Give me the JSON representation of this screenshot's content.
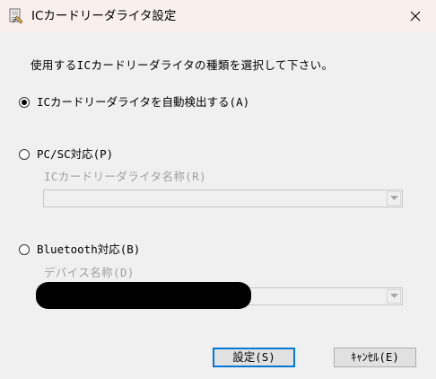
{
  "window": {
    "title": "ICカードリーダライタ設定",
    "icon": "card-reader-settings-icon",
    "close_icon": "close-icon"
  },
  "instruction": "使用するICカードリーダライタの種類を選択して下さい。",
  "options": {
    "auto": {
      "label": "ICカードリーダライタを自動検出する(A)",
      "checked": true
    },
    "pcsc": {
      "label": "PC/SC対応(P)",
      "checked": false,
      "field_label": "ICカードリーダライタ名称(R)",
      "field_value": ""
    },
    "bluetooth": {
      "label": "Bluetooth対応(B)",
      "checked": false,
      "field_label": "デバイス名称(D)",
      "field_value": ""
    }
  },
  "buttons": {
    "ok": "設定(S)",
    "cancel": "ｷｬﾝｾﾙ(E)"
  },
  "colors": {
    "titlebar": "#f9f0ee",
    "window_bg": "#f0f0f0",
    "disabled_text": "#a0a0a0",
    "default_button_border": "#0078d7"
  }
}
